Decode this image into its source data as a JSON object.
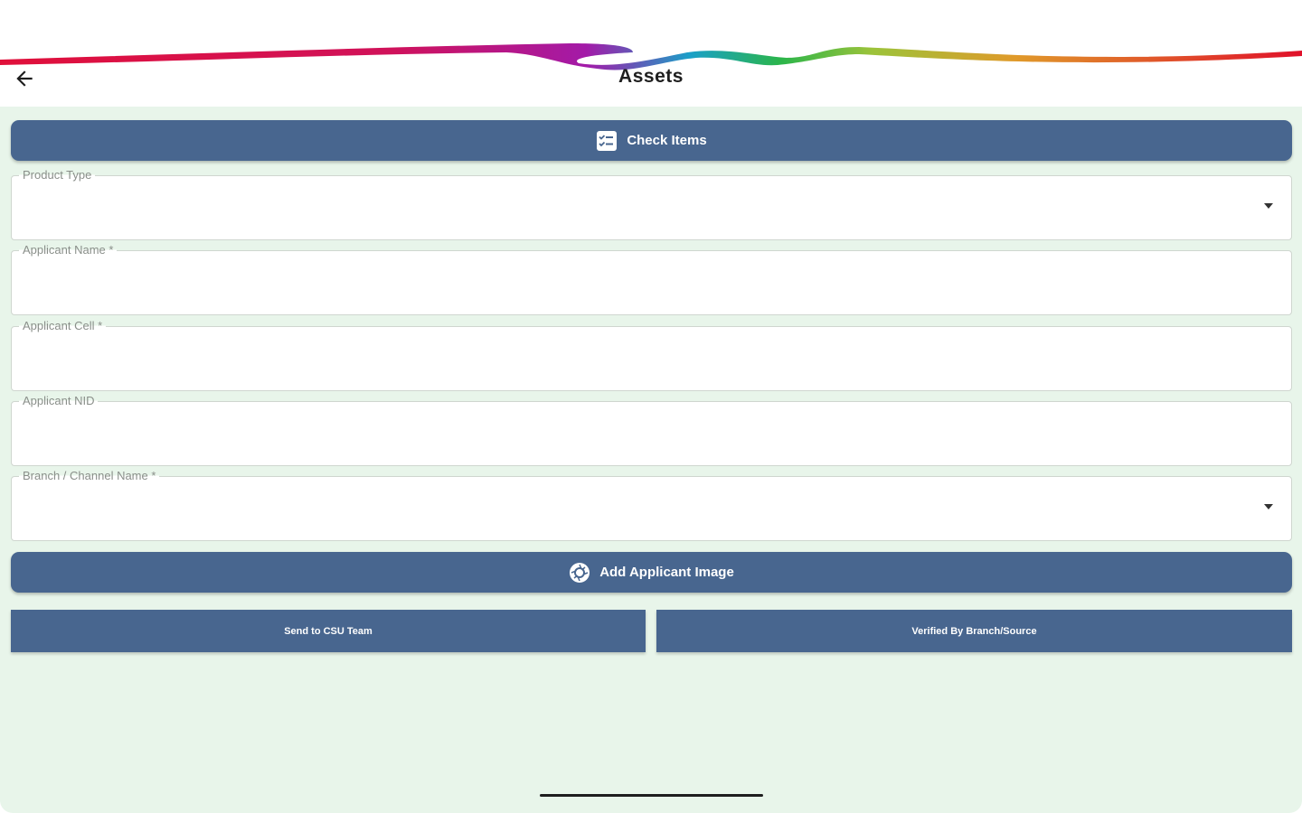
{
  "header": {
    "title": "Assets"
  },
  "actions": {
    "check_items_label": "Check Items",
    "add_image_label": "Add Applicant Image",
    "send_csu_label": "Send to CSU Team",
    "verified_label": "Verified By Branch/Source"
  },
  "form": {
    "product_type": {
      "label": "Product Type",
      "value": ""
    },
    "applicant_name": {
      "label": "Applicant Name *",
      "value": ""
    },
    "applicant_cell": {
      "label": "Applicant Cell *",
      "value": ""
    },
    "applicant_nid": {
      "label": "Applicant NID",
      "value": ""
    },
    "branch_channel": {
      "label": "Branch / Channel Name *",
      "value": ""
    }
  },
  "colors": {
    "button": "#48668f",
    "panel": "#e8f5ea",
    "field_bg": "#ffffff"
  },
  "icons": {
    "back": "arrow-left-icon",
    "check_items": "checklist-icon",
    "add_image": "camera-icon",
    "dropdown": "chevron-down-icon"
  }
}
